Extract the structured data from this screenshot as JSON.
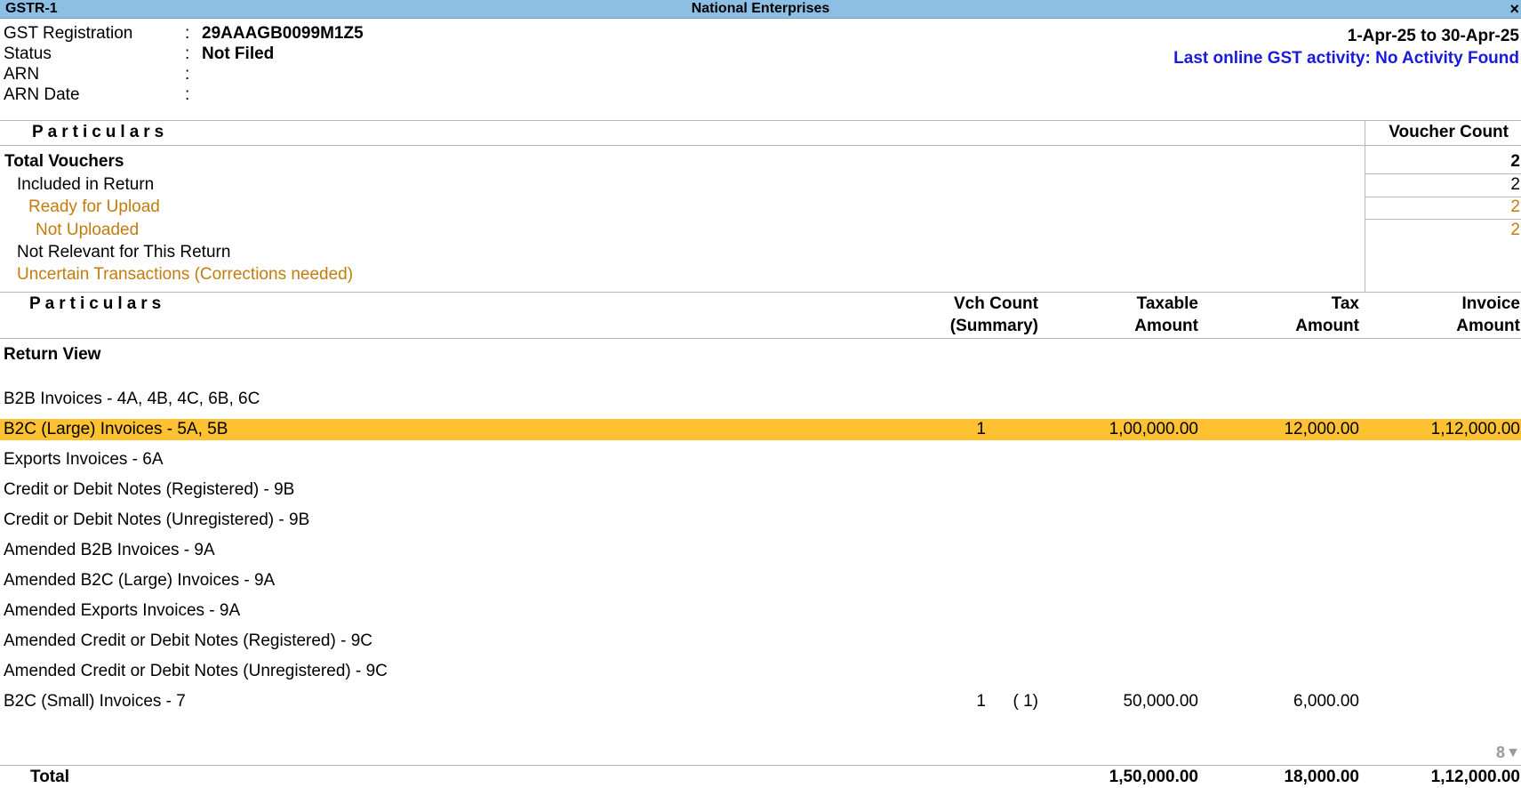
{
  "window": {
    "title": "GSTR-1",
    "company": "National Enterprises",
    "close_glyph": "×"
  },
  "info": {
    "gst_registration_label": "GST Registration",
    "gst_registration_value": "29AAAGB0099M1Z5",
    "status_label": "Status",
    "status_value": "Not Filed",
    "arn_label": "ARN",
    "arn_value": "",
    "arn_date_label": "ARN Date",
    "arn_date_value": "",
    "colon": ":",
    "period": "1-Apr-25 to 30-Apr-25",
    "last_activity": "Last online GST activity: No Activity Found"
  },
  "summary": {
    "particulars_header": "Particulars",
    "voucher_count_header": "Voucher Count",
    "rows": [
      {
        "label": "Total Vouchers",
        "value": "2"
      },
      {
        "label": "Included in Return",
        "value": "2"
      },
      {
        "label": "Ready for Upload",
        "value": "2"
      },
      {
        "label": "Not Uploaded",
        "value": "2"
      },
      {
        "label": "Not Relevant for This Return",
        "value": ""
      },
      {
        "label": "Uncertain Transactions (Corrections needed)",
        "value": ""
      }
    ]
  },
  "return_view": {
    "particulars_header": "Particulars",
    "col_vch_1": "Vch Count",
    "col_vch_2": "(Summary)",
    "col_taxable_1": "Taxable",
    "col_taxable_2": "Amount",
    "col_tax_1": "Tax",
    "col_tax_2": "Amount",
    "col_invoice_1": "Invoice",
    "col_invoice_2": "Amount",
    "section_title": "Return View",
    "rows": [
      {
        "name": "B2B Invoices - 4A, 4B, 4C, 6B, 6C",
        "vch": "",
        "summary": "",
        "taxable": "",
        "tax": "",
        "invoice": ""
      },
      {
        "name": "B2C (Large) Invoices - 5A, 5B",
        "vch": "1",
        "summary": "",
        "taxable": "1,00,000.00",
        "tax": "12,000.00",
        "invoice": "1,12,000.00"
      },
      {
        "name": "Exports Invoices - 6A",
        "vch": "",
        "summary": "",
        "taxable": "",
        "tax": "",
        "invoice": ""
      },
      {
        "name": "Credit or Debit Notes (Registered) - 9B",
        "vch": "",
        "summary": "",
        "taxable": "",
        "tax": "",
        "invoice": ""
      },
      {
        "name": "Credit or Debit Notes (Unregistered) - 9B",
        "vch": "",
        "summary": "",
        "taxable": "",
        "tax": "",
        "invoice": ""
      },
      {
        "name": "Amended B2B Invoices - 9A",
        "vch": "",
        "summary": "",
        "taxable": "",
        "tax": "",
        "invoice": ""
      },
      {
        "name": "Amended B2C (Large) Invoices - 9A",
        "vch": "",
        "summary": "",
        "taxable": "",
        "tax": "",
        "invoice": ""
      },
      {
        "name": "Amended Exports Invoices - 9A",
        "vch": "",
        "summary": "",
        "taxable": "",
        "tax": "",
        "invoice": ""
      },
      {
        "name": "Amended Credit or Debit Notes (Registered) - 9C",
        "vch": "",
        "summary": "",
        "taxable": "",
        "tax": "",
        "invoice": ""
      },
      {
        "name": "Amended Credit or Debit Notes (Unregistered) - 9C",
        "vch": "",
        "summary": "",
        "taxable": "",
        "tax": "",
        "invoice": ""
      },
      {
        "name": "B2C (Small) Invoices - 7",
        "vch": "1",
        "summary": "( 1)",
        "taxable": "50,000.00",
        "tax": "6,000.00",
        "invoice": ""
      }
    ],
    "page_number": "8",
    "total": {
      "label": "Total",
      "taxable": "1,50,000.00",
      "tax": "18,000.00",
      "invoice": "1,12,000.00"
    }
  },
  "colors": {
    "title_bar": "#8dbee3",
    "selected_row": "#fdc131",
    "orange_text": "#c27c0e",
    "activity_text": "#1a1adc"
  }
}
